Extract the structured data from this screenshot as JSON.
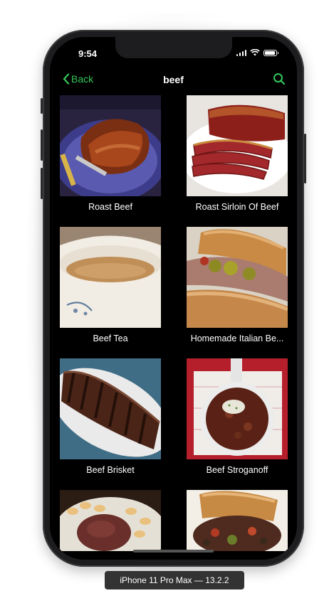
{
  "status": {
    "time": "9:54",
    "battery_level": 0.85
  },
  "navbar": {
    "back_label": "Back",
    "title": "beef",
    "accent_color": "#34c759",
    "back_icon": "chevron-left-icon",
    "search_icon": "search-icon"
  },
  "recipes": [
    {
      "label": "Roast Beef"
    },
    {
      "label": "Roast Sirloin Of Beef"
    },
    {
      "label": "Beef Tea"
    },
    {
      "label": "Homemade Italian Be..."
    },
    {
      "label": "Beef Brisket"
    },
    {
      "label": "Beef Stroganoff"
    },
    {
      "label": ""
    },
    {
      "label": ""
    }
  ],
  "device_label": "iPhone 11 Pro Max — 13.2.2"
}
